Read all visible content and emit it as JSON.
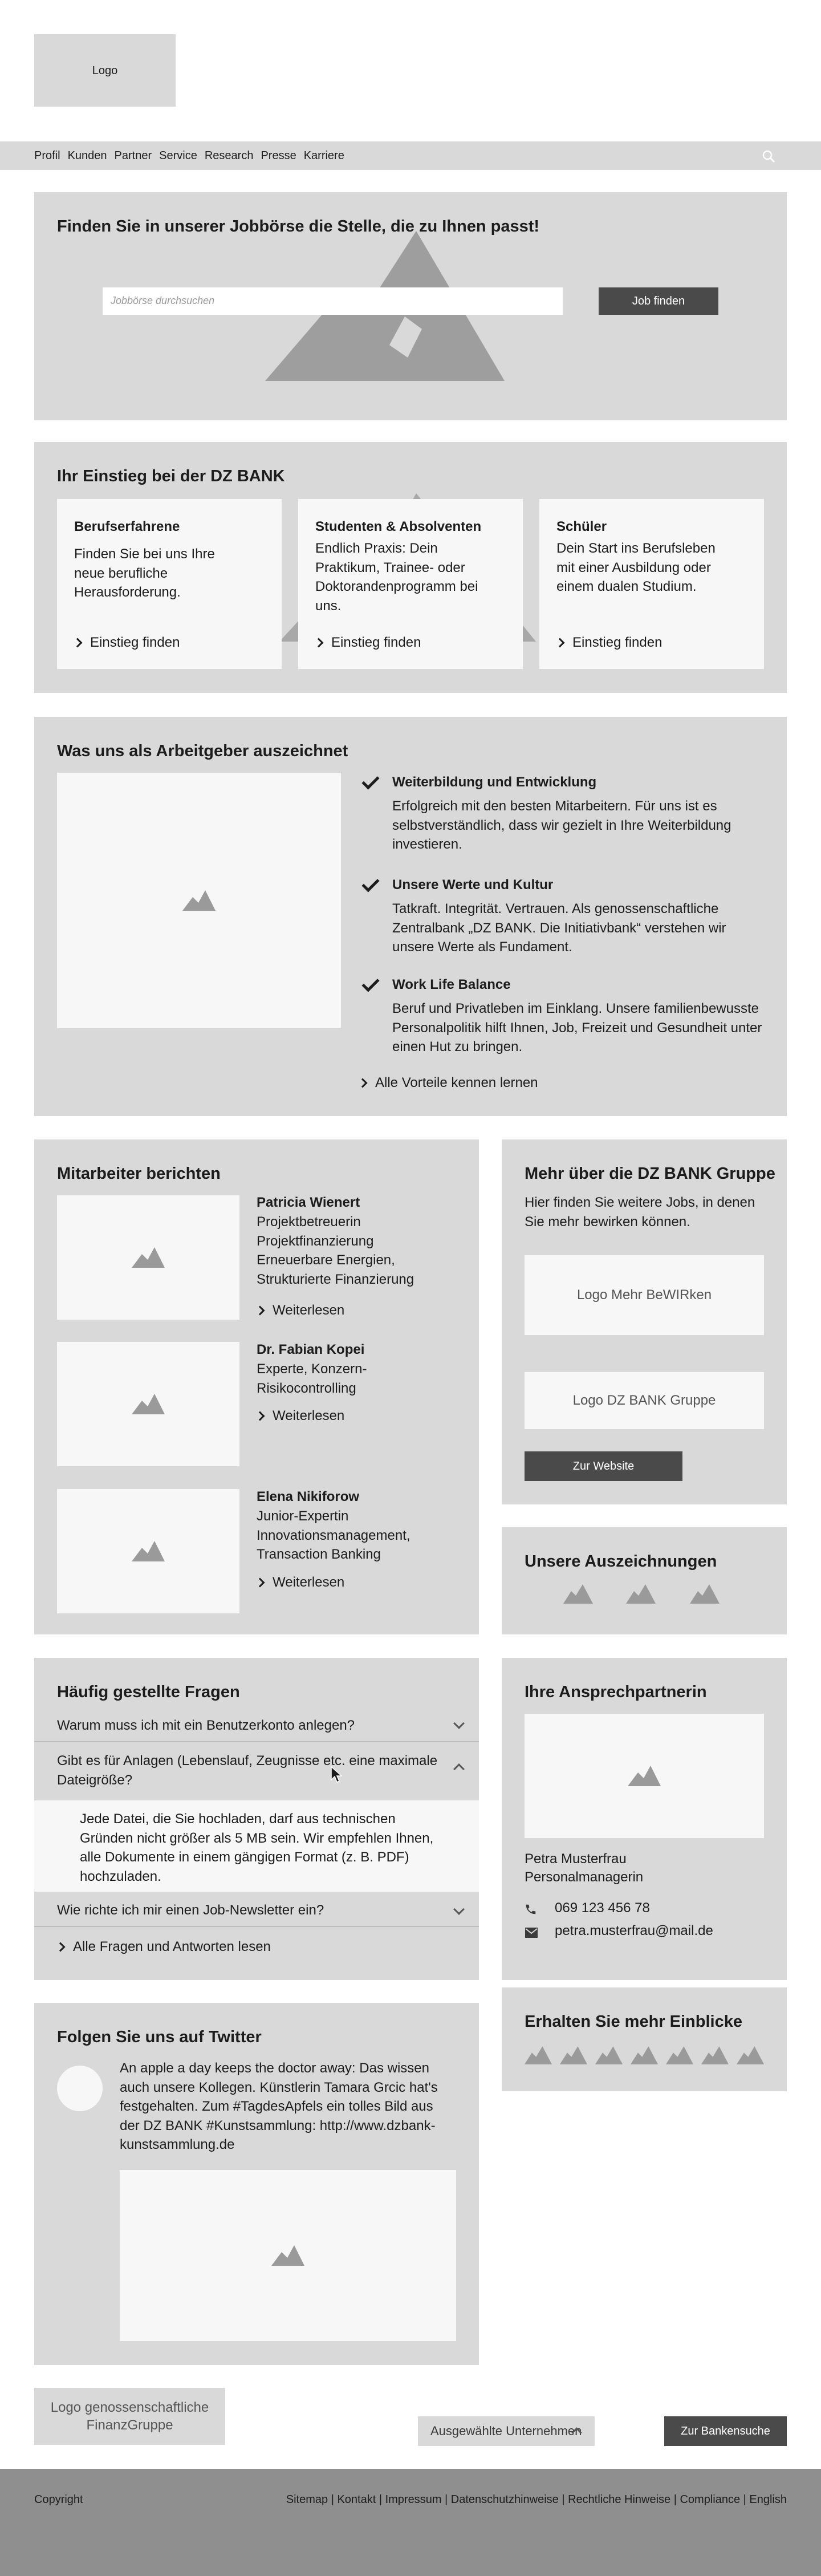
{
  "header": {
    "logo": "Logo",
    "nav": [
      "Profil",
      "Kunden",
      "Partner",
      "Service",
      "Research",
      "Presse",
      "Karriere"
    ]
  },
  "hero": {
    "title": "Finden Sie in unserer Jobbörse die Stelle, die zu Ihnen passt!",
    "search_placeholder": "Jobbörse durchsuchen",
    "button": "Job finden"
  },
  "einstieg": {
    "title": "Ihr Einstieg bei der DZ BANK",
    "cards": [
      {
        "title": "Berufserfahrene",
        "text": "Finden Sie bei uns Ihre neue berufliche Herausforderung.",
        "link": "Einstieg finden"
      },
      {
        "title": "Studenten & Absolventen",
        "text": "Endlich Praxis: Dein Praktikum, Trainee- oder Doktorandenprogramm bei uns.",
        "link": "Einstieg finden"
      },
      {
        "title": "Schüler",
        "text": "Dein Start ins Berufsleben mit einer Ausbildung oder einem dualen Studium.",
        "link": "Einstieg finden"
      }
    ]
  },
  "arbeitgeber": {
    "title": "Was uns als Arbeitgeber auszeichnet",
    "items": [
      {
        "title": "Weiterbildung und  Entwicklung",
        "text": "Erfolgreich mit den besten Mitarbeitern. Für uns ist es selbstverständlich, dass wir gezielt in Ihre Weiterbildung investieren."
      },
      {
        "title": "Unsere Werte und Kultur",
        "text": "Tatkraft. Integrität. Vertrauen. Als genossenschaftliche Zentralbank „DZ BANK. Die Initiativbank“ verstehen wir unsere Werte als Fundament."
      },
      {
        "title": "Work Life Balance",
        "text": "Beruf und Privatleben im Einklang. Unsere familienbewusste Personalpolitik hilft Ihnen, Job, Freizeit und Gesundheit unter einen Hut zu bringen."
      }
    ],
    "link": "Alle Vorteile kennen lernen"
  },
  "mitarbeiter": {
    "title": "Mitarbeiter berichten",
    "people": [
      {
        "name": "Patricia Wienert",
        "role": "Projektbetreuerin Projektfinanzierung Erneuerbare Energien, Strukturierte Finanzierung",
        "link": "Weiterlesen"
      },
      {
        "name": "Dr. Fabian Kopei",
        "role": "Experte, Konzern-Risikocontrolling",
        "link": "Weiterlesen"
      },
      {
        "name": "Elena Nikiforow",
        "role": "Junior-Expertin Innovationsmanagement, Transaction Banking",
        "link": "Weiterlesen"
      }
    ]
  },
  "gruppe": {
    "title": "Mehr über die DZ BANK Gruppe",
    "text": "Hier finden Sie weitere Jobs, in denen Sie mehr bewirken können.",
    "logo1": "Logo Mehr BeWIRken",
    "logo2": "Logo DZ BANK Gruppe",
    "button": "Zur Website"
  },
  "auszeichnungen": {
    "title": "Unsere Auszeichnungen"
  },
  "faq": {
    "title": "Häufig gestellte Fragen",
    "q1": "Warum muss ich mit ein Benutzerkonto anlegen?",
    "q2": "Gibt es für Anlagen (Lebenslauf, Zeugnisse etc. eine maximale Dateigröße?",
    "a2": "Jede Datei, die Sie hochladen, darf aus technischen Gründen nicht größer als 5 MB sein. Wir empfehlen Ihnen, alle Dokumente in einem gängigen Format (z. B. PDF) hochzuladen.",
    "q3": "Wie richte ich mir einen Job-Newsletter ein?",
    "link": "Alle Fragen und Antworten lesen"
  },
  "ansprech": {
    "title": "Ihre Ansprechpartnerin",
    "name": "Petra Musterfrau",
    "role": "Personalmanagerin",
    "phone": "069 123 456 78",
    "email": "petra.musterfrau@mail.de"
  },
  "twitter": {
    "title": "Folgen Sie uns auf Twitter",
    "text": "An apple a day keeps the doctor away: Das wissen auch unsere Kollegen. Künstlerin Tamara Grcic hat's festgehalten. Zum #TagdesApfels ein tolles Bild aus der DZ BANK #Kunstsammlung: http://www.dzbank-kunstsammlung.de"
  },
  "einblicke": {
    "title": "Erhalten Sie mehr Einblicke"
  },
  "footer_top": {
    "logo": "Logo genossenschaftliche FinanzGruppe",
    "select": "Ausgewählte Unternehmen",
    "button": "Zur Bankensuche"
  },
  "footer": {
    "copyright": "Copyright",
    "links": "Sitemap | Kontakt | Impressum | Datenschutzhinweise | Rechtliche Hinweise | Compliance | English"
  },
  "colors": {
    "panel": "#d9d9d9",
    "dark_button": "#4a4a4a",
    "footer": "#8f8f8f",
    "icon": "#9a9a9a"
  }
}
